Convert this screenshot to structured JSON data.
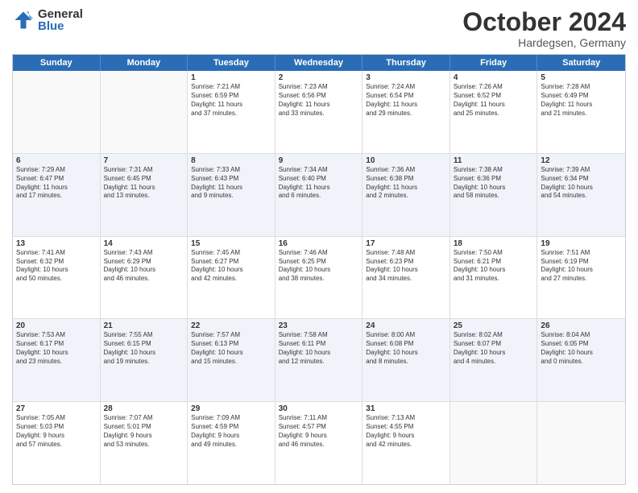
{
  "header": {
    "logo_general": "General",
    "logo_blue": "Blue",
    "month_title": "October 2024",
    "location": "Hardegsen, Germany"
  },
  "days_of_week": [
    "Sunday",
    "Monday",
    "Tuesday",
    "Wednesday",
    "Thursday",
    "Friday",
    "Saturday"
  ],
  "rows": [
    {
      "alt": false,
      "cells": [
        {
          "day": "",
          "text": ""
        },
        {
          "day": "",
          "text": ""
        },
        {
          "day": "1",
          "text": "Sunrise: 7:21 AM\nSunset: 6:59 PM\nDaylight: 11 hours\nand 37 minutes."
        },
        {
          "day": "2",
          "text": "Sunrise: 7:23 AM\nSunset: 6:56 PM\nDaylight: 11 hours\nand 33 minutes."
        },
        {
          "day": "3",
          "text": "Sunrise: 7:24 AM\nSunset: 6:54 PM\nDaylight: 11 hours\nand 29 minutes."
        },
        {
          "day": "4",
          "text": "Sunrise: 7:26 AM\nSunset: 6:52 PM\nDaylight: 11 hours\nand 25 minutes."
        },
        {
          "day": "5",
          "text": "Sunrise: 7:28 AM\nSunset: 6:49 PM\nDaylight: 11 hours\nand 21 minutes."
        }
      ]
    },
    {
      "alt": true,
      "cells": [
        {
          "day": "6",
          "text": "Sunrise: 7:29 AM\nSunset: 6:47 PM\nDaylight: 11 hours\nand 17 minutes."
        },
        {
          "day": "7",
          "text": "Sunrise: 7:31 AM\nSunset: 6:45 PM\nDaylight: 11 hours\nand 13 minutes."
        },
        {
          "day": "8",
          "text": "Sunrise: 7:33 AM\nSunset: 6:43 PM\nDaylight: 11 hours\nand 9 minutes."
        },
        {
          "day": "9",
          "text": "Sunrise: 7:34 AM\nSunset: 6:40 PM\nDaylight: 11 hours\nand 6 minutes."
        },
        {
          "day": "10",
          "text": "Sunrise: 7:36 AM\nSunset: 6:38 PM\nDaylight: 11 hours\nand 2 minutes."
        },
        {
          "day": "11",
          "text": "Sunrise: 7:38 AM\nSunset: 6:36 PM\nDaylight: 10 hours\nand 58 minutes."
        },
        {
          "day": "12",
          "text": "Sunrise: 7:39 AM\nSunset: 6:34 PM\nDaylight: 10 hours\nand 54 minutes."
        }
      ]
    },
    {
      "alt": false,
      "cells": [
        {
          "day": "13",
          "text": "Sunrise: 7:41 AM\nSunset: 6:32 PM\nDaylight: 10 hours\nand 50 minutes."
        },
        {
          "day": "14",
          "text": "Sunrise: 7:43 AM\nSunset: 6:29 PM\nDaylight: 10 hours\nand 46 minutes."
        },
        {
          "day": "15",
          "text": "Sunrise: 7:45 AM\nSunset: 6:27 PM\nDaylight: 10 hours\nand 42 minutes."
        },
        {
          "day": "16",
          "text": "Sunrise: 7:46 AM\nSunset: 6:25 PM\nDaylight: 10 hours\nand 38 minutes."
        },
        {
          "day": "17",
          "text": "Sunrise: 7:48 AM\nSunset: 6:23 PM\nDaylight: 10 hours\nand 34 minutes."
        },
        {
          "day": "18",
          "text": "Sunrise: 7:50 AM\nSunset: 6:21 PM\nDaylight: 10 hours\nand 31 minutes."
        },
        {
          "day": "19",
          "text": "Sunrise: 7:51 AM\nSunset: 6:19 PM\nDaylight: 10 hours\nand 27 minutes."
        }
      ]
    },
    {
      "alt": true,
      "cells": [
        {
          "day": "20",
          "text": "Sunrise: 7:53 AM\nSunset: 6:17 PM\nDaylight: 10 hours\nand 23 minutes."
        },
        {
          "day": "21",
          "text": "Sunrise: 7:55 AM\nSunset: 6:15 PM\nDaylight: 10 hours\nand 19 minutes."
        },
        {
          "day": "22",
          "text": "Sunrise: 7:57 AM\nSunset: 6:13 PM\nDaylight: 10 hours\nand 15 minutes."
        },
        {
          "day": "23",
          "text": "Sunrise: 7:58 AM\nSunset: 6:11 PM\nDaylight: 10 hours\nand 12 minutes."
        },
        {
          "day": "24",
          "text": "Sunrise: 8:00 AM\nSunset: 6:08 PM\nDaylight: 10 hours\nand 8 minutes."
        },
        {
          "day": "25",
          "text": "Sunrise: 8:02 AM\nSunset: 6:07 PM\nDaylight: 10 hours\nand 4 minutes."
        },
        {
          "day": "26",
          "text": "Sunrise: 8:04 AM\nSunset: 6:05 PM\nDaylight: 10 hours\nand 0 minutes."
        }
      ]
    },
    {
      "alt": false,
      "cells": [
        {
          "day": "27",
          "text": "Sunrise: 7:05 AM\nSunset: 5:03 PM\nDaylight: 9 hours\nand 57 minutes."
        },
        {
          "day": "28",
          "text": "Sunrise: 7:07 AM\nSunset: 5:01 PM\nDaylight: 9 hours\nand 53 minutes."
        },
        {
          "day": "29",
          "text": "Sunrise: 7:09 AM\nSunset: 4:59 PM\nDaylight: 9 hours\nand 49 minutes."
        },
        {
          "day": "30",
          "text": "Sunrise: 7:11 AM\nSunset: 4:57 PM\nDaylight: 9 hours\nand 46 minutes."
        },
        {
          "day": "31",
          "text": "Sunrise: 7:13 AM\nSunset: 4:55 PM\nDaylight: 9 hours\nand 42 minutes."
        },
        {
          "day": "",
          "text": ""
        },
        {
          "day": "",
          "text": ""
        }
      ]
    }
  ]
}
